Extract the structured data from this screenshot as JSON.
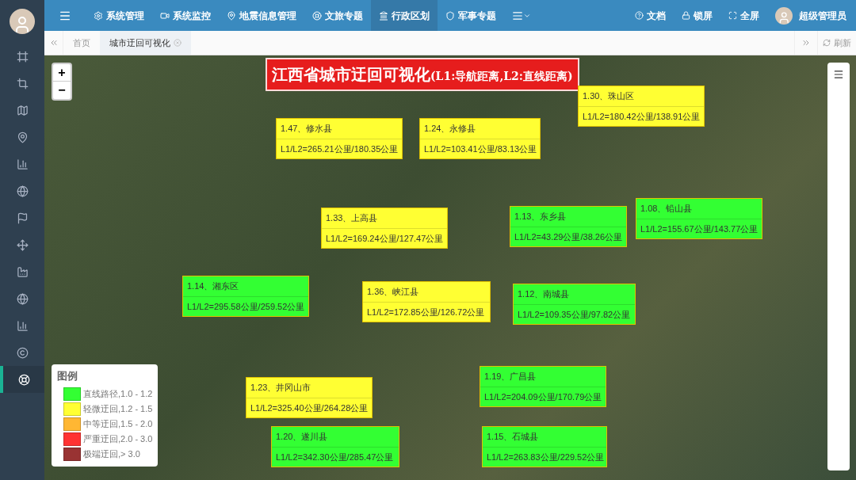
{
  "topnav": {
    "items": [
      {
        "label": "系统管理",
        "selected": false
      },
      {
        "label": "系统监控",
        "selected": false
      },
      {
        "label": "地震信息管理",
        "selected": false
      },
      {
        "label": "文旅专题",
        "selected": false
      },
      {
        "label": "行政区划",
        "selected": true
      },
      {
        "label": "军事专题",
        "selected": false
      }
    ],
    "right": [
      "文档",
      "锁屏",
      "全屏"
    ],
    "user": "超级管理员"
  },
  "sidebar": {
    "items": [
      {
        "selected": false
      },
      {
        "selected": false
      },
      {
        "selected": false
      },
      {
        "selected": false
      },
      {
        "selected": false
      },
      {
        "selected": false
      },
      {
        "selected": false
      },
      {
        "selected": false
      },
      {
        "selected": false
      },
      {
        "selected": false
      },
      {
        "selected": false
      },
      {
        "selected": false
      },
      {
        "selected": true
      }
    ]
  },
  "tabs": [
    {
      "label": "首页",
      "selected": false
    },
    {
      "label": "城市迂回可视化",
      "selected": true
    }
  ],
  "refresh": "刷新",
  "map": {
    "title": "江西省城市迂回可视化",
    "subtitle": "(L1:导航距离,L2:直线距离)",
    "labels": [
      {
        "name": "1.47、修水县",
        "value": "L1/L2=265.21公里/180.35公里",
        "color": "#ffff33"
      },
      {
        "name": "1.24、永修县",
        "value": "L1/L2=103.41公里/83.13公里",
        "color": "#ffff33"
      },
      {
        "name": "1.30、珠山区",
        "value": "L1/L2=180.42公里/138.91公里",
        "color": "#ffff33"
      },
      {
        "name": "1.33、上高县",
        "value": "L1/L2=169.24公里/127.47公里",
        "color": "#ffff33"
      },
      {
        "name": "1.13、东乡县",
        "value": "L1/L2=43.29公里/38.26公里",
        "color": "#33ff33"
      },
      {
        "name": "1.08、铅山县",
        "value": "L1/L2=155.67公里/143.77公里",
        "color": "#33ff33"
      },
      {
        "name": "1.14、湘东区",
        "value": "L1/L2=295.58公里/259.52公里",
        "color": "#33ff33"
      },
      {
        "name": "1.36、峡江县",
        "value": "L1/L2=172.85公里/126.72公里",
        "color": "#ffff33"
      },
      {
        "name": "1.12、南城县",
        "value": "L1/L2=109.35公里/97.82公里",
        "color": "#33ff33"
      },
      {
        "name": "1.19、广昌县",
        "value": "L1/L2=204.09公里/170.79公里",
        "color": "#33ff33"
      },
      {
        "name": "1.23、井冈山市",
        "value": "L1/L2=325.40公里/264.28公里",
        "color": "#ffff33"
      },
      {
        "name": "1.20、遂川县",
        "value": "L1/L2=342.30公里/285.47公里",
        "color": "#33ff33"
      },
      {
        "name": "1.15、石城县",
        "value": "L1/L2=263.83公里/229.52公里",
        "color": "#33ff33"
      }
    ],
    "zoom": [
      "+",
      "−"
    ],
    "legend": {
      "title": "图例",
      "items": [
        {
          "label": "直线路径,1.0 - 1.2",
          "color": "#33ff33"
        },
        {
          "label": "轻微迂回,1.2 - 1.5",
          "color": "#ffff33"
        },
        {
          "label": "中等迂回,1.5 - 2.0",
          "color": "#ffb733"
        },
        {
          "label": "严重迂回,2.0 - 3.0",
          "color": "#ff3333"
        },
        {
          "label": "极端迂回,> 3.0",
          "color": "#993333"
        }
      ]
    }
  }
}
